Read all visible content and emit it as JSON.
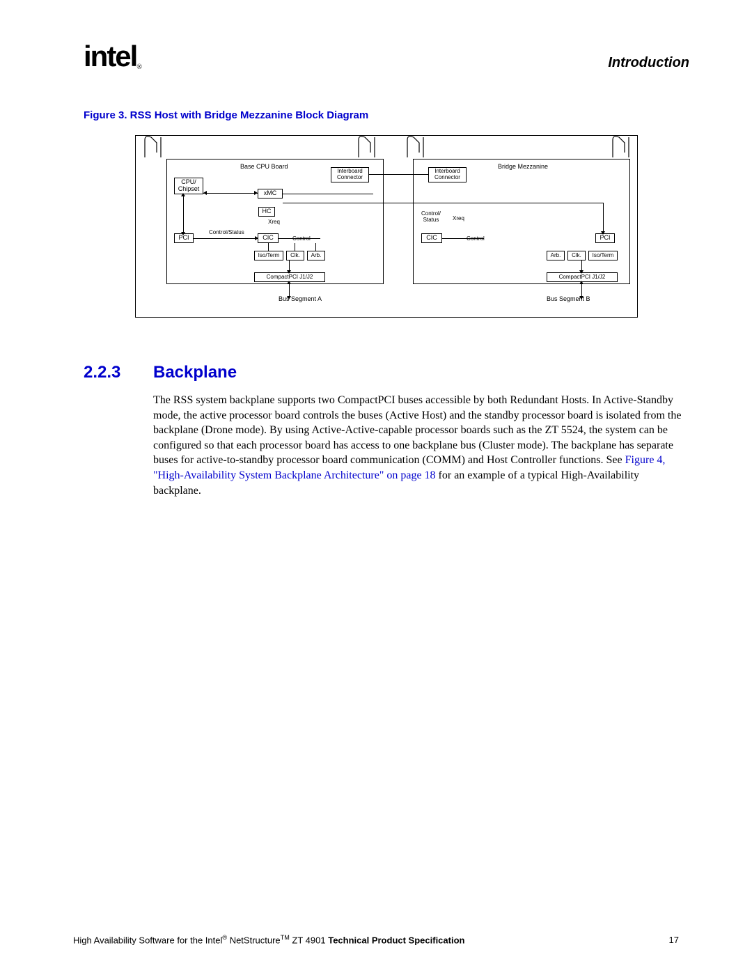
{
  "header": {
    "logo_text": "intel",
    "logo_mark": "®",
    "section": "Introduction"
  },
  "figure": {
    "caption": "Figure 3.  RSS Host with Bridge Mezzanine Block Diagram",
    "labels": {
      "base_board": "Base CPU Board",
      "bridge_mezz": "Bridge Mezzanine",
      "interboard1": "Interboard\nConnector",
      "interboard2": "Interboard\nConnector",
      "cpu": "CPU/\nChipset",
      "xmc": "xMC",
      "hc": "HC",
      "xreq1": "Xreq",
      "xreq2": "Xreq",
      "ctrl_status1": "Control/Status",
      "ctrl_status2": "Control/\nStatus",
      "pci1": "PCI",
      "pci2": "PCI",
      "cic1": "CIC",
      "cic2": "CIC",
      "control1": "Control",
      "control2": "Control",
      "iso1": "Iso/Term",
      "iso2": "Iso/Term",
      "clk1": "Clk.",
      "clk2": "Clk.",
      "arb1": "Arb.",
      "arb2": "Arb.",
      "cpci1": "CompactPCI J1/J2",
      "cpci2": "CompactPCI J1/J2",
      "busA": "Bus Segment A",
      "busB": "Bus Segment B"
    }
  },
  "section": {
    "number": "2.2.3",
    "title": "Backplane",
    "para1": "The RSS system backplane supports two CompactPCI buses accessible by both Redundant Hosts. In Active-Standby mode, the active processor board controls the buses (Active Host) and the standby processor board is isolated from the backplane (Drone mode). By using Active-Active-capable processor boards such as the ZT 5524, the system can be configured so that each processor board has access to one backplane bus (Cluster mode). The backplane has separate buses for active-to-standby processor board communication (COMM) and Host Controller functions. See ",
    "link": "Figure 4, \"High-Availability System Backplane Architecture\" on page 18",
    "para2": " for an example of a typical High-Availability backplane."
  },
  "footer": {
    "text_pre": "High Availability Software for the Intel",
    "reg": "®",
    "text_mid": " NetStructure",
    "tm": "TM",
    "text_post": " ZT 4901 ",
    "bold": "Technical Product Specification",
    "page": "17"
  }
}
